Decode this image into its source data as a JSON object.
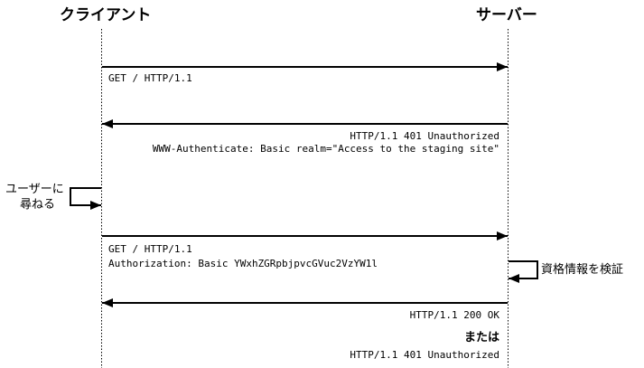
{
  "actors": {
    "client": "クライアント",
    "server": "サーバー"
  },
  "messages": [
    {
      "direction": "to-server",
      "lines": [
        "GET / HTTP/1.1"
      ]
    },
    {
      "direction": "to-client",
      "lines": [
        "HTTP/1.1 401 Unauthorized",
        "WWW-Authenticate: Basic realm=\"Access to the staging site\""
      ]
    },
    {
      "direction": "to-server",
      "lines": [
        "GET / HTTP/1.1",
        "Authorization: Basic YWxhZGRpbjpvcGVuc2VzYW1l"
      ]
    },
    {
      "direction": "to-client",
      "lines": [
        "HTTP/1.1 200 OK"
      ]
    }
  ],
  "notes": {
    "client_self": [
      "ユーザーに",
      "尋ねる"
    ],
    "server_self": "資格情報を検証"
  },
  "alternative": {
    "separator": "または",
    "response": "HTTP/1.1 401 Unauthorized"
  }
}
